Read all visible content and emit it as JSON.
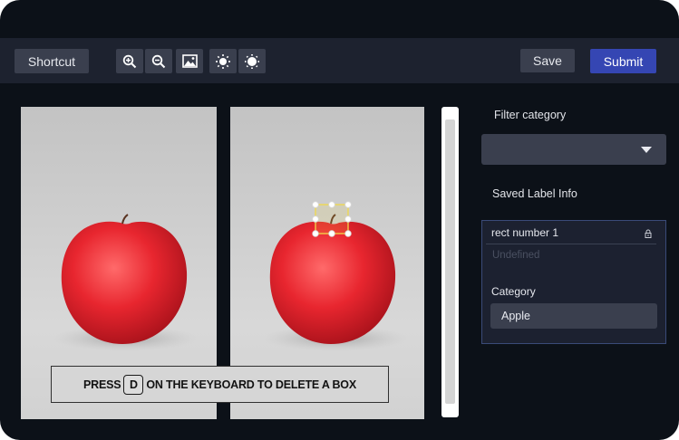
{
  "toolbar": {
    "shortcut_label": "Shortcut",
    "tools": [
      {
        "icon": "zoom-in-icon"
      },
      {
        "icon": "zoom-out-icon"
      },
      {
        "icon": "image-icon"
      },
      {
        "icon": "brightness-up-icon"
      },
      {
        "icon": "brightness-down-icon"
      }
    ],
    "save_label": "Save",
    "submit_label": "Submit"
  },
  "canvas": {
    "banner_prefix": "PRESS",
    "banner_key": "D",
    "banner_suffix": "ON THE KEYBOARD TO DELETE A BOX"
  },
  "sidebar": {
    "filter_label": "Filter category",
    "filter_value": "",
    "saved_label": "Saved Label Info",
    "label_item": {
      "name": "rect number 1",
      "description_placeholder": "Undefined",
      "category_label": "Category",
      "category_value": "Apple"
    }
  },
  "colors": {
    "background": "#0c1118",
    "toolbar": "#1d222f",
    "button": "#3a3f4e",
    "accent": "#3546b3",
    "bbox": "#f2d94a"
  }
}
